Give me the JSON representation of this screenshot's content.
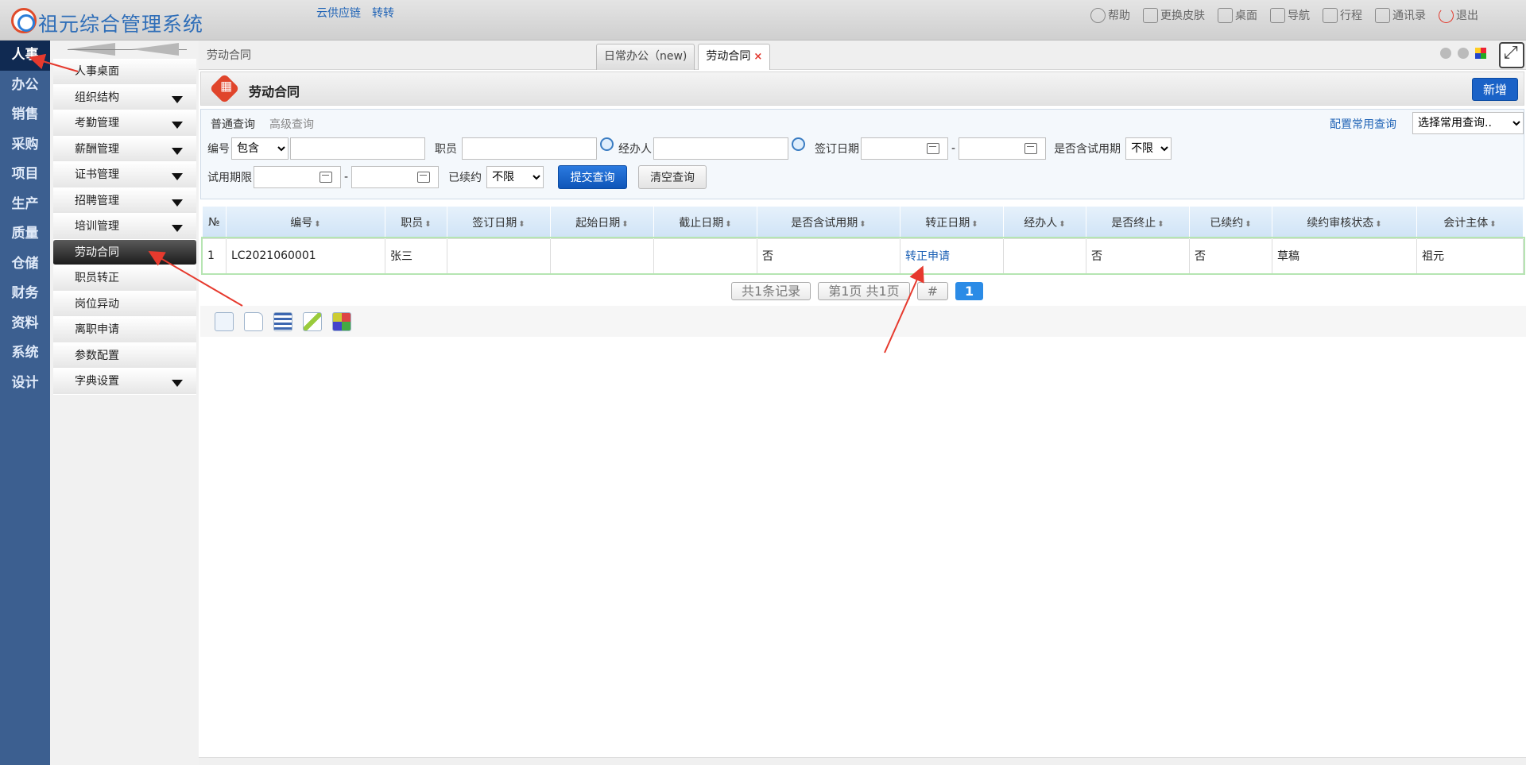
{
  "app": {
    "title": "祖元综合管理系统",
    "top_links": [
      "云供应链",
      "转转"
    ],
    "top_actions": [
      {
        "label": "帮助",
        "icon": "help-icon"
      },
      {
        "label": "更换皮肤",
        "icon": "shirt-icon"
      },
      {
        "label": "桌面",
        "icon": "home-icon"
      },
      {
        "label": "导航",
        "icon": "grid-icon"
      },
      {
        "label": "行程",
        "icon": "calendar-icon"
      },
      {
        "label": "通讯录",
        "icon": "contacts-icon"
      },
      {
        "label": "退出",
        "icon": "power-icon"
      }
    ]
  },
  "modules": [
    "人事",
    "办公",
    "销售",
    "采购",
    "项目",
    "生产",
    "质量",
    "仓储",
    "财务",
    "资料",
    "系统",
    "设计"
  ],
  "active_module": "人事",
  "submenu": [
    {
      "label": "人事桌面",
      "caret": false
    },
    {
      "label": "组织结构",
      "caret": true
    },
    {
      "label": "考勤管理",
      "caret": true
    },
    {
      "label": "薪酬管理",
      "caret": true
    },
    {
      "label": "证书管理",
      "caret": true
    },
    {
      "label": "招聘管理",
      "caret": true
    },
    {
      "label": "培训管理",
      "caret": true
    },
    {
      "label": "劳动合同",
      "caret": false,
      "active": true
    },
    {
      "label": "职员转正",
      "caret": false
    },
    {
      "label": "岗位异动",
      "caret": false
    },
    {
      "label": "离职申请",
      "caret": false
    },
    {
      "label": "参数配置",
      "caret": false
    },
    {
      "label": "字典设置",
      "caret": true
    }
  ],
  "breadcrumb": "劳动合同",
  "tabs": [
    {
      "label": "日常办公（new)"
    },
    {
      "label": "劳动合同",
      "close": "×"
    }
  ],
  "panel": {
    "title": "劳动合同",
    "new_label": "新增"
  },
  "query": {
    "tab_normal": "普通查询",
    "tab_advanced": "高级查询",
    "config_link": "配置常用查询",
    "common_select": "选择常用查询..",
    "code_label": "编号",
    "code_op": "包含",
    "employee_label": "职员",
    "handler_label": "经办人",
    "sign_date_label": "签订日期",
    "trial_label": "是否含试用期",
    "trial_value": "不限",
    "trial_limit_label": "试用期限",
    "renewed_label": "已续约",
    "renewed_value": "不限",
    "dash": "-",
    "submit_label": "提交查询",
    "clear_label": "清空查询"
  },
  "grid": {
    "columns": [
      "№",
      "编号",
      "职员",
      "签订日期",
      "起始日期",
      "截止日期",
      "是否含试用期",
      "转正日期",
      "经办人",
      "是否终止",
      "已续约",
      "续约审核状态",
      "会计主体"
    ],
    "sort_glyph": "⬍",
    "rows": [
      [
        "1",
        "LC2021060001",
        "张三",
        "",
        "",
        "",
        "否",
        "转正申请",
        "",
        "否",
        "否",
        "草稿",
        "祖元"
      ]
    ]
  },
  "pager": {
    "records": "共1条记录",
    "pages": "第1页 共1页",
    "jump": "#",
    "current": "1"
  },
  "colors": {
    "accent": "#1a62c7",
    "nav_bg": "#3c5f90",
    "annotation": "#e63a2e"
  }
}
